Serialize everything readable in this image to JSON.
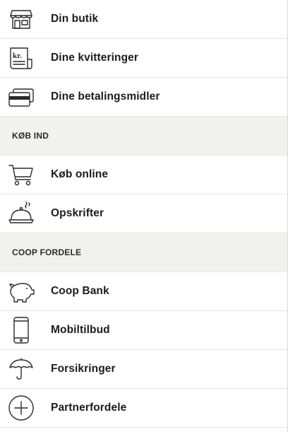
{
  "menu": {
    "items_top": [
      {
        "label": "Din butik",
        "icon": "store-icon"
      },
      {
        "label": "Dine kvitteringer",
        "icon": "receipt-icon"
      },
      {
        "label": "Dine betalingsmidler",
        "icon": "payment-cards-icon"
      }
    ],
    "section_buy": {
      "title": "KØB IND",
      "items": [
        {
          "label": "Køb online",
          "icon": "shopping-cart-icon"
        },
        {
          "label": "Opskrifter",
          "icon": "cloche-icon"
        }
      ]
    },
    "section_benefits": {
      "title": "COOP FORDELE",
      "items": [
        {
          "label": "Coop Bank",
          "icon": "piggy-bank-icon"
        },
        {
          "label": "Mobiltilbud",
          "icon": "mobile-phone-icon"
        },
        {
          "label": "Forsikringer",
          "icon": "umbrella-icon"
        },
        {
          "label": "Partnerfordele",
          "icon": "plus-circle-icon"
        }
      ]
    },
    "receipt_icon_text": "kr."
  }
}
